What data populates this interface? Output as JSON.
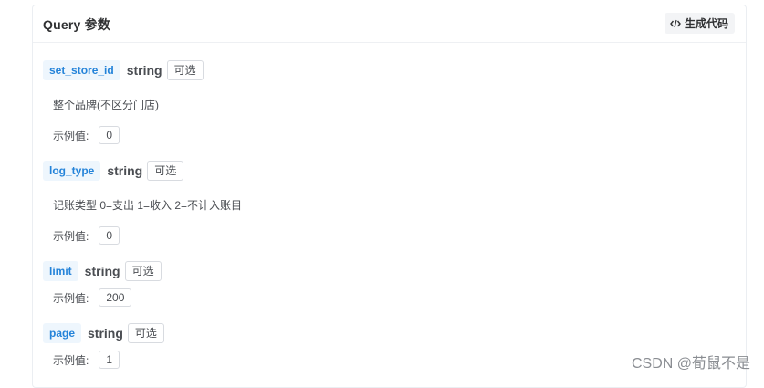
{
  "panel": {
    "title": "Query 参数",
    "generate_button_label": "生成代码"
  },
  "params": [
    {
      "name": "set_store_id",
      "type": "string",
      "optional_label": "可选",
      "description": "整个品牌(不区分门店)",
      "example_label": "示例值:",
      "example_value": "0"
    },
    {
      "name": "log_type",
      "type": "string",
      "optional_label": "可选",
      "description": "记账类型 0=支出 1=收入 2=不计入账目",
      "example_label": "示例值:",
      "example_value": "0"
    },
    {
      "name": "limit",
      "type": "string",
      "optional_label": "可选",
      "description": "",
      "example_label": "示例值:",
      "example_value": "200"
    },
    {
      "name": "page",
      "type": "string",
      "optional_label": "可选",
      "description": "",
      "example_label": "示例值:",
      "example_value": "1"
    }
  ],
  "watermark": "CSDN @荀鼠不是",
  "icons": {
    "generate": "code-icon"
  },
  "colors": {
    "param_name_text": "#2483d9",
    "param_name_bg": "#eef6fd"
  }
}
